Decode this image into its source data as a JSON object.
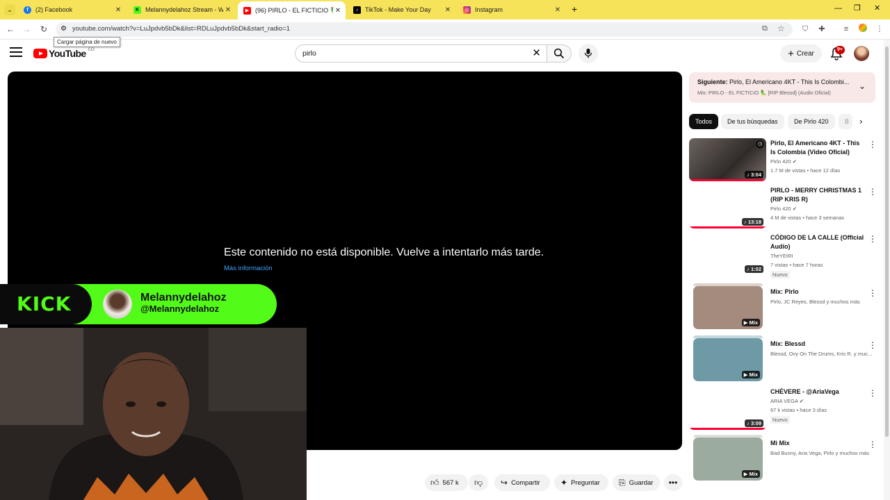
{
  "browser": {
    "tabs": [
      {
        "label": "(2) Facebook",
        "icon": "facebook-icon",
        "color": "#1877f2"
      },
      {
        "label": "Melannydelahoz Stream - Watc",
        "icon": "kick-icon",
        "color": "#53fc18"
      },
      {
        "label": "(96) PIRLO - EL FICTICIO 🦜 [R",
        "icon": "youtube-icon",
        "color": "#ff0000"
      },
      {
        "label": "TikTok - Make Your Day",
        "icon": "tiktok-icon",
        "color": "#000000"
      },
      {
        "label": "Instagram",
        "icon": "instagram-icon",
        "color": "#e1306c"
      }
    ],
    "url": "youtube.com/watch?v=LuJpdvb5bDk&list=RDLuJpdvb5bDk&start_radio=1",
    "reload_tooltip": "Cargar página de nuevo"
  },
  "header": {
    "logo_text": "YouTube",
    "country_code": "CO",
    "search_value": "pirlo",
    "create_label": "Crear",
    "notifications_badge": "9+"
  },
  "player": {
    "error_message": "Este contenido no está disponible. Vuelve a intentarlo más tarde.",
    "more_info": "Más información"
  },
  "overlay": {
    "kick_logo": "KICK",
    "streamer_name": "Melannydelahoz",
    "streamer_handle": "@Melannydelahoz"
  },
  "actions": {
    "likes": "567 k",
    "share": "Compartir",
    "ask": "Preguntar",
    "save": "Guardar"
  },
  "sidebar": {
    "next_prefix": "Siguiente:",
    "next_title": "Pirlo, El Americano 4KT - This Is Colombi...",
    "next_sub": "Mix: PIRLO - EL FICTICIO 🦜 [RIP Blessd] (Audio Oficial)",
    "chips": [
      "Todos",
      "De tus búsquedas",
      "De Pirlo 420",
      "B"
    ],
    "recs": [
      {
        "title": "Pirlo, El Americano 4KT - This Is Colombia (Video Oficial)",
        "channel": "Pirlo 420",
        "stats": "1.7 M de vistas • hace 12 días",
        "duration": "3:04",
        "color": "#4a4442"
      },
      {
        "title": "PIRLO - MERRY CHRISTMAS 1 (RIP KRIS R)",
        "channel": "Pirlo 420",
        "stats": "4 M de vistas • hace 3 semanas",
        "duration": "13:18",
        "color": "#ffffff"
      },
      {
        "title": "CÓDIGO DE LA CALLE (Official Audio)",
        "channel": "TheYEIRI",
        "stats": "7 vistas • hace 7 horas",
        "badge": "Nuevo",
        "duration": "1:02",
        "color": "#ffffff"
      },
      {
        "title": "Mix: Pirlo",
        "channel": "Pirlo, JC Reyes, Blessd y muchos más",
        "duration": "Mix",
        "color": "#a48b7e"
      },
      {
        "title": "Mix: Blessd",
        "channel": "Blessd, Ovy On The Drums, Kris R. y muc...",
        "duration": "Mix",
        "color": "#6e9aa6"
      },
      {
        "title": "CHÉVERE - @AriaVega",
        "channel": "ARIA VEGA",
        "stats": "67 k vistas • hace 3 días",
        "badge": "Nuevo",
        "duration": "3:09",
        "color": "#ffffff"
      },
      {
        "title": "Mi Mix",
        "channel": "Bad Bunny, Aria Vega, Pirlo y muchos más",
        "duration": "Mix",
        "color": "#9cab9f"
      }
    ]
  }
}
